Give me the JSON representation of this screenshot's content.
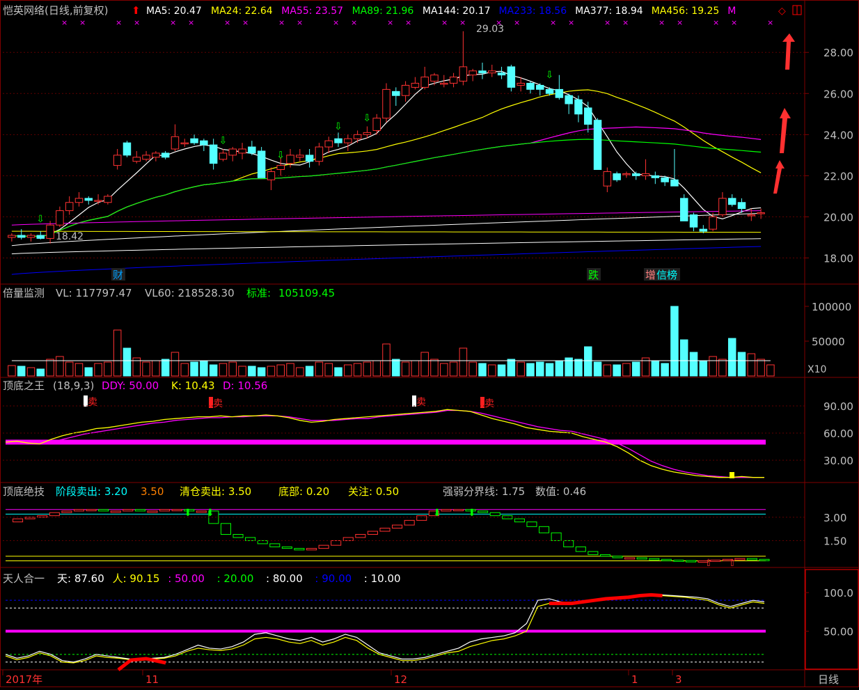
{
  "panels": {
    "main": {
      "title": "恺英网络(日线,前复权)",
      "ma_legend": [
        {
          "label": "MA5: 20.47",
          "color": "#ffffff"
        },
        {
          "label": "MA24: 22.64",
          "color": "#ffff00"
        },
        {
          "label": "MA55: 23.57",
          "color": "#ff00ff"
        },
        {
          "label": "MA89: 21.96",
          "color": "#00ff00"
        },
        {
          "label": "MA144: 20.17",
          "color": "#ffffff"
        },
        {
          "label": "MA233: 18.56",
          "color": "#0000ff"
        },
        {
          "label": "MA377: 18.94",
          "color": "#ffffff"
        },
        {
          "label": "MA456: 19.25",
          "color": "#ffff00"
        },
        {
          "label": "M",
          "color": "#ff00ff"
        }
      ],
      "y_ticks": [
        "28.00",
        "26.00",
        "24.00",
        "22.00",
        "20.00",
        "18.00"
      ],
      "high_label": "29.03",
      "low_label": "18.42",
      "event_tags": [
        {
          "label": "财",
          "color": "#00a0ff"
        },
        {
          "label": "跌",
          "color": "#00ff00"
        },
        {
          "label": "增",
          "color": "#ff8080"
        },
        {
          "label": "信榜",
          "color": "#00ffff"
        }
      ]
    },
    "volume": {
      "title": "倍量监测",
      "vl": "VL: 117797.47",
      "vl60": "VL60: 218528.30",
      "std_label": "标准:",
      "std_value": "105109.45",
      "y_ticks": [
        "100000",
        "50000"
      ],
      "unit": "X10"
    },
    "kdj": {
      "title": "顶底之王",
      "params": "(18,9,3)",
      "ddy": "DDY: 50.00",
      "k": "K: 10.43",
      "d": "D: 10.56",
      "y_ticks": [
        "90.00",
        "60.00",
        "30.00"
      ],
      "signal": "卖"
    },
    "stage": {
      "title": "顶底绝技",
      "items": [
        {
          "label": "阶段卖出: 3.20",
          "color": "#00ffff"
        },
        {
          "label": "3.50",
          "color": "#ff8000"
        },
        {
          "label": "清仓卖出: 3.50",
          "color": "#ffff00"
        },
        {
          "label": "底部: 0.20",
          "color": "#ffff00"
        },
        {
          "label": "关注: 0.50",
          "color": "#ffff00"
        },
        {
          "label": "强弱分界线: 1.75",
          "color": "#c0c0c0"
        },
        {
          "label": "数值: 0.46",
          "color": "#c0c0c0"
        }
      ],
      "y_ticks": [
        "3.00",
        "1.50"
      ]
    },
    "trh": {
      "title": "天人合一",
      "items": [
        {
          "label": "天: 87.60",
          "color": "#ffffff"
        },
        {
          "label": "人: 90.15",
          "color": "#ffff00"
        },
        {
          "label": ": 50.00",
          "color": "#ff00ff"
        },
        {
          "label": ": 20.00",
          "color": "#00ff00"
        },
        {
          "label": ": 80.00",
          "color": "#ffffff"
        },
        {
          "label": ": 90.00",
          "color": "#0000ff"
        },
        {
          "label": ": 10.00",
          "color": "#ffffff"
        }
      ],
      "y_ticks": [
        "100.0",
        "50.00"
      ]
    }
  },
  "x_axis": {
    "labels": [
      "2017年",
      "11",
      "12",
      "1",
      "3"
    ],
    "period": "日线"
  },
  "colors": {
    "up": "#ff3232",
    "down": "#54ffff",
    "grid": "#800000",
    "axis_text": "#c0c0c0"
  },
  "chart_data": {
    "type": "candlestick",
    "ylim": [
      17.0,
      29.6
    ],
    "candles": [
      [
        19.0,
        19.2,
        18.8,
        19.1
      ],
      [
        19.1,
        19.4,
        18.9,
        19.0
      ],
      [
        19.0,
        19.2,
        18.8,
        19.1
      ],
      [
        19.1,
        19.3,
        18.9,
        18.95
      ],
      [
        18.95,
        19.8,
        18.7,
        19.6
      ],
      [
        19.6,
        20.5,
        19.5,
        20.3
      ],
      [
        20.3,
        21.0,
        20.1,
        20.7
      ],
      [
        20.7,
        21.2,
        20.5,
        20.9
      ],
      [
        20.9,
        21.0,
        20.6,
        20.8
      ],
      [
        20.8,
        21.1,
        20.6,
        20.8
      ],
      [
        20.7,
        21.1,
        20.6,
        21.0
      ],
      [
        22.5,
        23.3,
        22.3,
        23.0
      ],
      [
        23.6,
        23.7,
        22.9,
        23.0
      ],
      [
        22.7,
        23.2,
        22.6,
        22.9
      ],
      [
        22.8,
        23.2,
        22.7,
        23.0
      ],
      [
        22.9,
        23.2,
        22.7,
        23.1
      ],
      [
        23.1,
        23.2,
        22.8,
        22.9
      ],
      [
        23.3,
        24.5,
        23.2,
        23.9
      ],
      [
        23.6,
        23.8,
        23.4,
        23.6
      ],
      [
        23.8,
        24.0,
        23.5,
        23.6
      ],
      [
        23.7,
        23.8,
        23.2,
        23.5
      ],
      [
        23.5,
        23.8,
        22.3,
        22.6
      ],
      [
        22.8,
        23.3,
        22.7,
        23.1
      ],
      [
        23.0,
        23.4,
        22.7,
        23.3
      ],
      [
        23.1,
        23.6,
        22.8,
        23.3
      ],
      [
        23.4,
        23.7,
        23.0,
        23.1
      ],
      [
        23.2,
        23.4,
        22.3,
        21.9
      ],
      [
        21.8,
        22.4,
        21.3,
        22.2
      ],
      [
        22.3,
        22.9,
        22.0,
        22.5
      ],
      [
        22.6,
        23.3,
        22.4,
        23.0
      ],
      [
        22.9,
        23.3,
        22.7,
        23.0
      ],
      [
        23.0,
        23.3,
        22.4,
        22.7
      ],
      [
        22.7,
        23.6,
        22.5,
        23.4
      ],
      [
        23.4,
        23.9,
        23.1,
        23.7
      ],
      [
        23.8,
        24.1,
        23.4,
        23.6
      ],
      [
        23.6,
        24.0,
        23.2,
        23.8
      ],
      [
        23.8,
        24.2,
        23.6,
        24.0
      ],
      [
        24.0,
        24.4,
        23.8,
        24.1
      ],
      [
        24.2,
        25.0,
        24.0,
        24.8
      ],
      [
        24.8,
        26.5,
        24.6,
        26.2
      ],
      [
        26.1,
        26.3,
        25.4,
        25.9
      ],
      [
        25.9,
        26.6,
        25.6,
        26.4
      ],
      [
        26.3,
        26.8,
        26.2,
        26.5
      ],
      [
        26.3,
        27.3,
        26.2,
        26.8
      ],
      [
        26.6,
        27.0,
        26.4,
        26.9
      ],
      [
        26.5,
        26.9,
        26.3,
        26.5
      ],
      [
        26.5,
        27.0,
        26.3,
        26.8
      ],
      [
        26.6,
        29.03,
        26.4,
        27.3
      ],
      [
        26.9,
        27.2,
        26.6,
        27.1
      ],
      [
        27.1,
        27.5,
        26.7,
        27.0
      ],
      [
        27.0,
        27.4,
        26.8,
        27.1
      ],
      [
        27.0,
        27.3,
        26.7,
        26.9
      ],
      [
        27.3,
        27.4,
        26.1,
        26.3
      ],
      [
        26.4,
        26.8,
        26.1,
        26.5
      ],
      [
        26.5,
        26.6,
        26.0,
        26.2
      ],
      [
        26.4,
        26.5,
        25.9,
        26.2
      ],
      [
        26.2,
        26.3,
        25.9,
        26.0
      ],
      [
        26.2,
        26.9,
        25.7,
        25.8
      ],
      [
        25.9,
        26.0,
        25.0,
        25.5
      ],
      [
        25.7,
        25.9,
        24.6,
        25.0
      ],
      [
        25.3,
        25.6,
        24.1,
        24.5
      ],
      [
        24.7,
        24.8,
        22.3,
        22.3
      ],
      [
        21.5,
        22.4,
        21.2,
        22.2
      ],
      [
        22.1,
        22.2,
        21.7,
        21.8
      ],
      [
        22.1,
        22.2,
        21.9,
        22.1
      ],
      [
        22.1,
        22.2,
        21.8,
        22.0
      ],
      [
        22.0,
        22.8,
        21.8,
        22.1
      ],
      [
        22.0,
        22.2,
        21.6,
        21.9
      ],
      [
        21.9,
        22.0,
        21.5,
        21.7
      ],
      [
        21.8,
        23.3,
        21.6,
        21.5
      ],
      [
        20.9,
        21.1,
        19.8,
        19.8
      ],
      [
        20.1,
        20.2,
        19.3,
        19.5
      ],
      [
        19.4,
        19.6,
        19.2,
        19.3
      ],
      [
        19.4,
        20.2,
        19.3,
        20.0
      ],
      [
        20.1,
        21.2,
        20.0,
        20.9
      ],
      [
        20.9,
        21.1,
        20.5,
        20.6
      ],
      [
        20.7,
        20.9,
        20.2,
        20.4
      ],
      [
        20.1,
        20.4,
        19.8,
        20.1
      ],
      [
        20.2,
        20.4,
        19.9,
        20.2
      ]
    ],
    "volume": [
      15,
      14,
      12,
      10,
      24,
      28,
      20,
      18,
      12,
      18,
      20,
      66,
      40,
      26,
      20,
      22,
      24,
      34,
      18,
      20,
      22,
      16,
      18,
      20,
      14,
      14,
      12,
      14,
      16,
      18,
      12,
      14,
      20,
      18,
      12,
      16,
      18,
      20,
      22,
      46,
      24,
      20,
      22,
      34,
      24,
      18,
      20,
      40,
      20,
      18,
      16,
      16,
      24,
      20,
      18,
      20,
      18,
      22,
      26,
      24,
      42,
      20,
      16,
      16,
      18,
      20,
      26,
      22,
      18,
      100,
      52,
      34,
      22,
      28,
      24,
      54,
      34,
      32,
      24,
      16
    ],
    "kdj_k": [
      50,
      51,
      49,
      48,
      53,
      57,
      60,
      62,
      65,
      66,
      68,
      70,
      72,
      73,
      75,
      76,
      77,
      78,
      78,
      79,
      78,
      79,
      79,
      80,
      79,
      77,
      74,
      72,
      73,
      75,
      76,
      77,
      78,
      79,
      80,
      81,
      82,
      83,
      84,
      86,
      85,
      84,
      80,
      76,
      73,
      70,
      66,
      64,
      62,
      61,
      60,
      56,
      53,
      50,
      45,
      38,
      30,
      24,
      20,
      17,
      15,
      13,
      12,
      11,
      11,
      12,
      11,
      11
    ],
    "kdj_d": [
      49,
      49,
      49,
      48,
      50,
      53,
      56,
      59,
      61,
      63,
      65,
      67,
      69,
      71,
      72,
      74,
      75,
      76,
      77,
      77,
      78,
      78,
      79,
      79,
      79,
      78,
      76,
      74,
      74,
      74,
      75,
      76,
      76,
      78,
      79,
      80,
      81,
      82,
      83,
      85,
      85,
      84,
      82,
      79,
      76,
      73,
      70,
      67,
      65,
      63,
      62,
      59,
      56,
      53,
      49,
      43,
      36,
      29,
      24,
      20,
      17,
      15,
      13,
      12,
      11,
      11,
      11,
      11
    ],
    "stage": [
      2.7,
      2.9,
      3.0,
      3.1,
      3.3,
      3.4,
      3.5,
      3.5,
      3.4,
      3.4,
      3.5,
      3.4,
      3.4,
      3.5,
      3.5,
      3.4,
      3.4,
      2.6,
      1.9,
      1.7,
      1.5,
      1.3,
      1.1,
      1.0,
      0.9,
      1.0,
      1.2,
      1.5,
      1.7,
      1.9,
      2.1,
      2.3,
      2.5,
      2.8,
      3.1,
      3.4,
      3.5,
      3.5,
      3.4,
      3.3,
      3.1,
      2.9,
      2.7,
      2.4,
      2.0,
      1.5,
      1.1,
      0.8,
      0.6,
      0.5,
      0.4,
      0.4,
      0.35,
      0.3,
      0.25,
      0.22,
      0.2,
      0.2,
      0.25,
      0.3,
      0.35,
      0.3,
      0.25
    ],
    "trh_tian": [
      20,
      15,
      18,
      24,
      20,
      12,
      10,
      14,
      20,
      18,
      16,
      14,
      13,
      15,
      16,
      20,
      26,
      32,
      28,
      27,
      30,
      36,
      46,
      48,
      44,
      40,
      38,
      42,
      36,
      40,
      46,
      42,
      32,
      22,
      18,
      14,
      14,
      16,
      20,
      24,
      28,
      36,
      40,
      42,
      44,
      48,
      60,
      90,
      92,
      88,
      86,
      88,
      90,
      92,
      93,
      94,
      96,
      98,
      97,
      96,
      95,
      94,
      92,
      86,
      82,
      86,
      90,
      88
    ],
    "trh_ren": [
      18,
      13,
      16,
      22,
      18,
      10,
      9,
      12,
      18,
      16,
      15,
      13,
      12,
      14,
      15,
      18,
      24,
      28,
      26,
      25,
      27,
      32,
      40,
      42,
      40,
      36,
      34,
      38,
      32,
      36,
      42,
      38,
      28,
      20,
      16,
      12,
      12,
      14,
      18,
      22,
      24,
      30,
      34,
      38,
      40,
      44,
      50,
      82,
      86,
      86,
      86,
      88,
      90,
      92,
      93,
      94,
      96,
      97,
      96,
      95,
      94,
      92,
      90,
      84,
      80,
      84,
      88,
      86
    ]
  }
}
